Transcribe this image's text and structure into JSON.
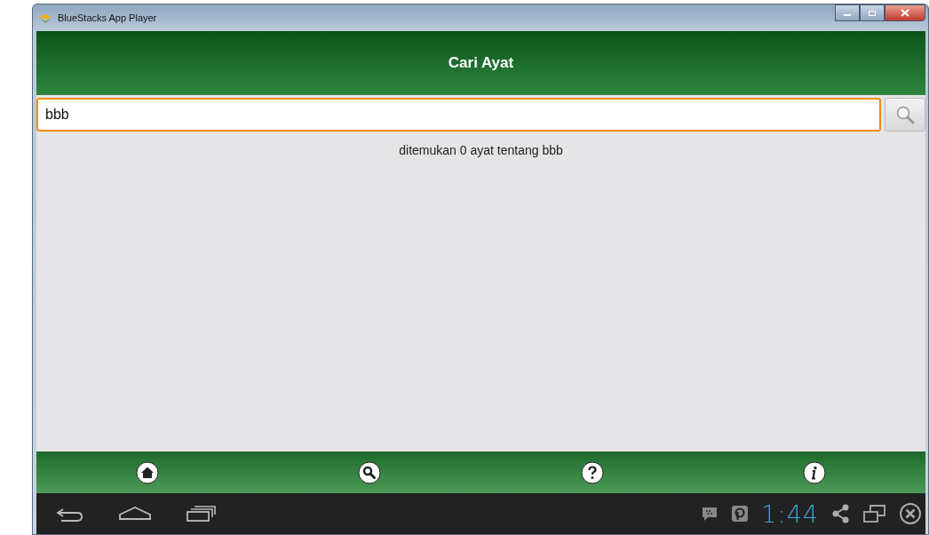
{
  "window": {
    "title": "BlueStacks App Player"
  },
  "header": {
    "title": "Cari Ayat"
  },
  "search": {
    "value": "bbb"
  },
  "result": "ditemukan 0 ayat tentang bbb",
  "bottom_nav": [
    {
      "kind": "home"
    },
    {
      "kind": "search"
    },
    {
      "kind": "help"
    },
    {
      "kind": "info"
    }
  ],
  "status_bar": {
    "time": "1:44"
  }
}
